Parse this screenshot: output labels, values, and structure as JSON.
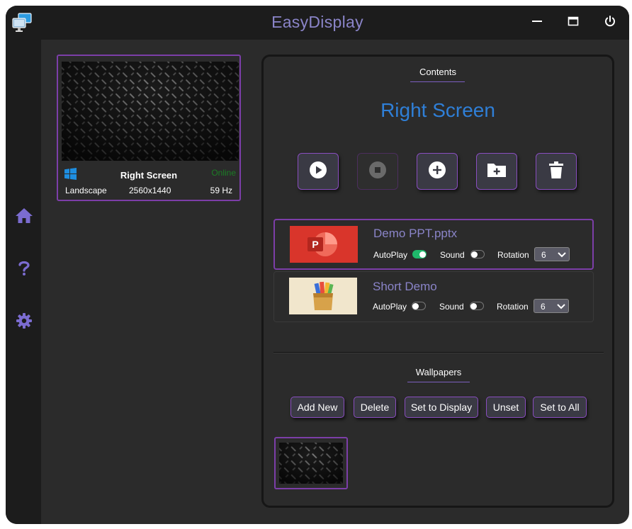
{
  "app": {
    "title": "EasyDisplay"
  },
  "titlebar": {
    "minimize_icon": "minimize-icon",
    "maximize_icon": "maximize-icon",
    "power_icon": "power-icon"
  },
  "sidebar": {
    "items": [
      {
        "icon": "home-icon"
      },
      {
        "icon": "help-icon"
      },
      {
        "icon": "settings-icon"
      }
    ]
  },
  "display_card": {
    "name": "Right Screen",
    "status": "Online",
    "orientation": "Landscape",
    "resolution": "2560x1440",
    "refresh_rate": "59 Hz",
    "os_icon": "windows-icon"
  },
  "content": {
    "section_title": "Contents",
    "screen_title": "Right Screen",
    "actions": [
      {
        "icon": "play-icon"
      },
      {
        "icon": "stop-icon",
        "disabled": true
      },
      {
        "icon": "add-icon"
      },
      {
        "icon": "add-folder-icon"
      },
      {
        "icon": "trash-icon"
      }
    ],
    "items": [
      {
        "name": "Demo PPT.pptx",
        "autoplay_label": "AutoPlay",
        "autoplay": true,
        "sound_label": "Sound",
        "sound": false,
        "rotation_label": "Rotation",
        "rotation": "6",
        "selected": true
      },
      {
        "name": "Short Demo",
        "autoplay_label": "AutoPlay",
        "autoplay": false,
        "sound_label": "Sound",
        "sound": false,
        "rotation_label": "Rotation",
        "rotation": "6",
        "selected": false
      }
    ]
  },
  "wallpapers": {
    "section_title": "Wallpapers",
    "buttons": {
      "add_new": "Add New",
      "delete": "Delete",
      "set_to_display": "Set to Display",
      "unset": "Unset",
      "set_to_all": "Set to All"
    }
  },
  "colors": {
    "accent_purple": "#7c3ea8",
    "title_blue": "#2f7fd7",
    "lavender_text": "#8a84c8",
    "online_green": "#1c7d25",
    "toggle_on": "#1fb96b"
  }
}
